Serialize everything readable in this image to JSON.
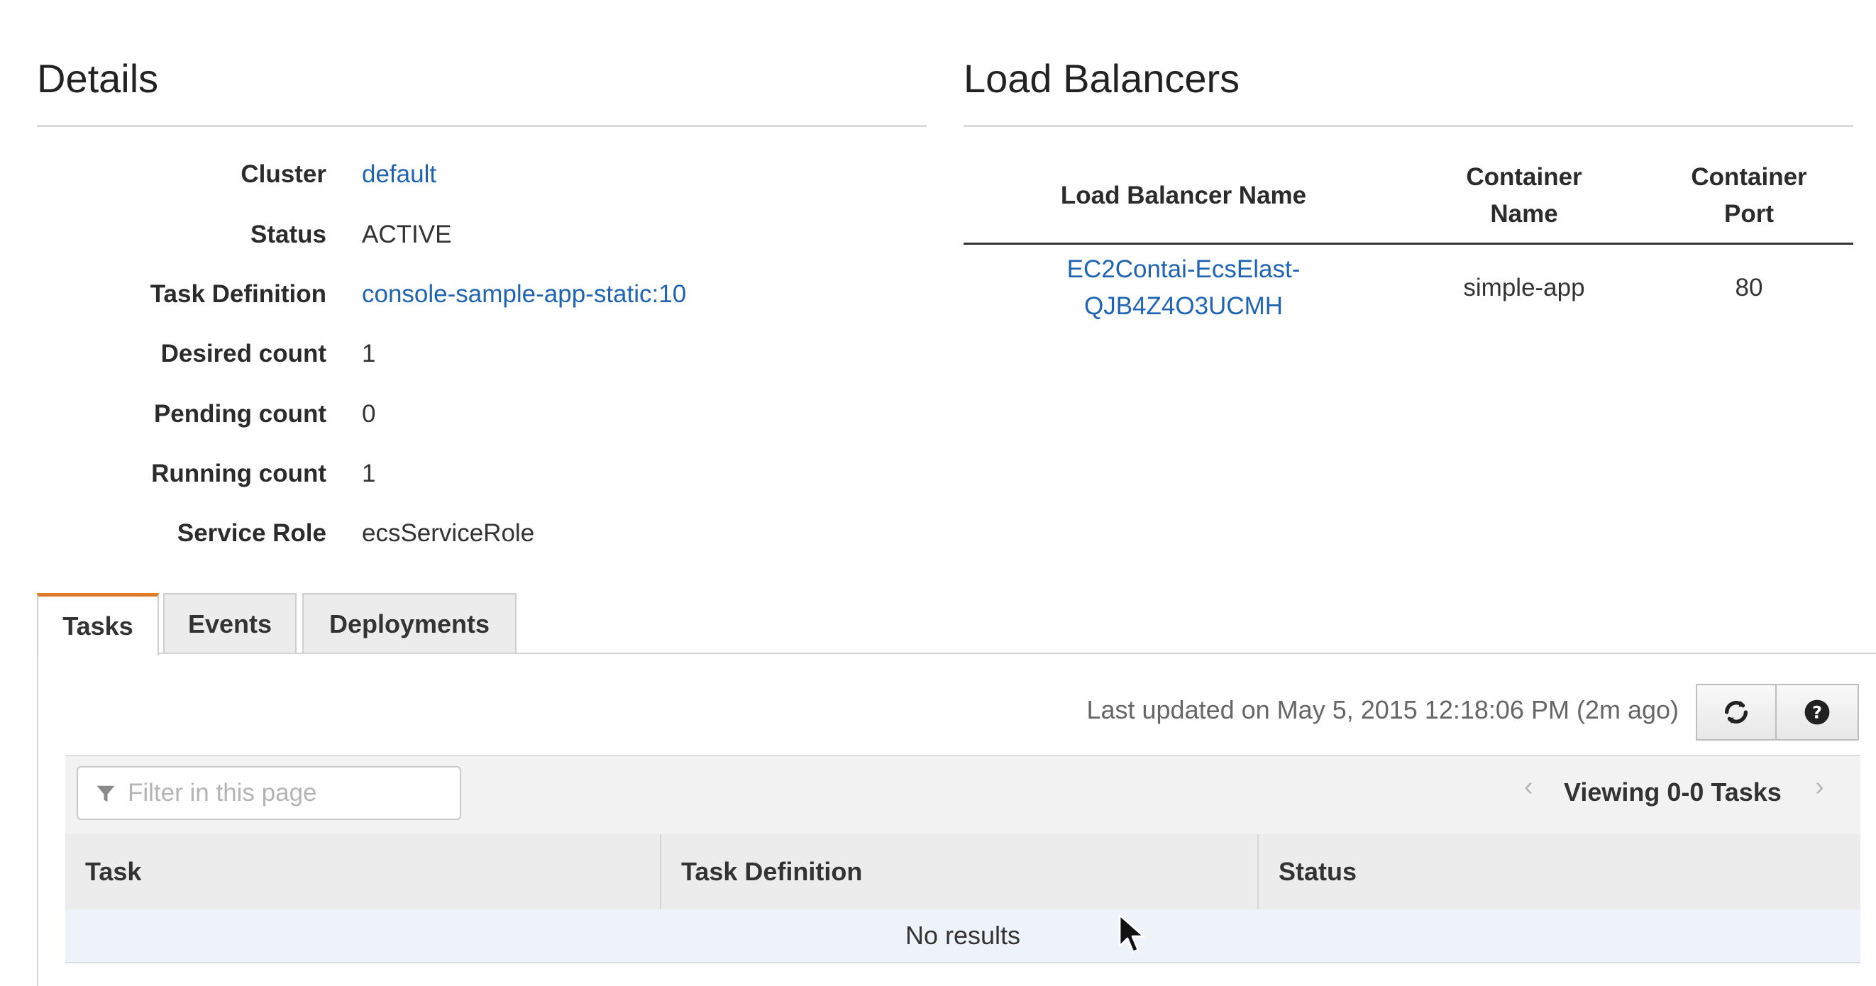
{
  "details": {
    "title": "Details",
    "rows": [
      {
        "label": "Cluster",
        "value": "default"
      },
      {
        "label": "Status",
        "value": "ACTIVE"
      },
      {
        "label": "Task Definition",
        "value": "console-sample-app-static:10"
      },
      {
        "label": "Desired count",
        "value": "1"
      },
      {
        "label": "Pending count",
        "value": "0"
      },
      {
        "label": "Running count",
        "value": "1"
      },
      {
        "label": "Service Role",
        "value": "ecsServiceRole"
      }
    ]
  },
  "load_balancers": {
    "title": "Load Balancers",
    "columns": {
      "name": "Load Balancer Name",
      "container_name_line1": "Container",
      "container_name_line2": "Name",
      "container_port_line1": "Container",
      "container_port_line2": "Port"
    },
    "rows": [
      {
        "name_line1": "EC2Contai-EcsElast-",
        "name_line2": "QJB4Z4O3UCMH",
        "container_name": "simple-app",
        "container_port": "80"
      }
    ]
  },
  "tabs": [
    {
      "label": "Tasks",
      "active": true
    },
    {
      "label": "Events",
      "active": false
    },
    {
      "label": "Deployments",
      "active": false
    }
  ],
  "tasks_panel": {
    "last_updated": "Last updated on May 5, 2015 12:18:06 PM (2m ago)",
    "refresh_icon": "refresh-icon",
    "help_icon": "help-icon",
    "filter_placeholder": "Filter in this page",
    "filter_icon": "filter-icon",
    "viewing": "Viewing 0-0 Tasks",
    "columns": [
      "Task",
      "Task Definition",
      "Status"
    ],
    "empty_message": "No results"
  },
  "colors": {
    "link": "#1f64b3",
    "active_tab_accent": "#e07b2a",
    "header_bg": "#ececec",
    "empty_row_bg": "#eef3f9"
  }
}
